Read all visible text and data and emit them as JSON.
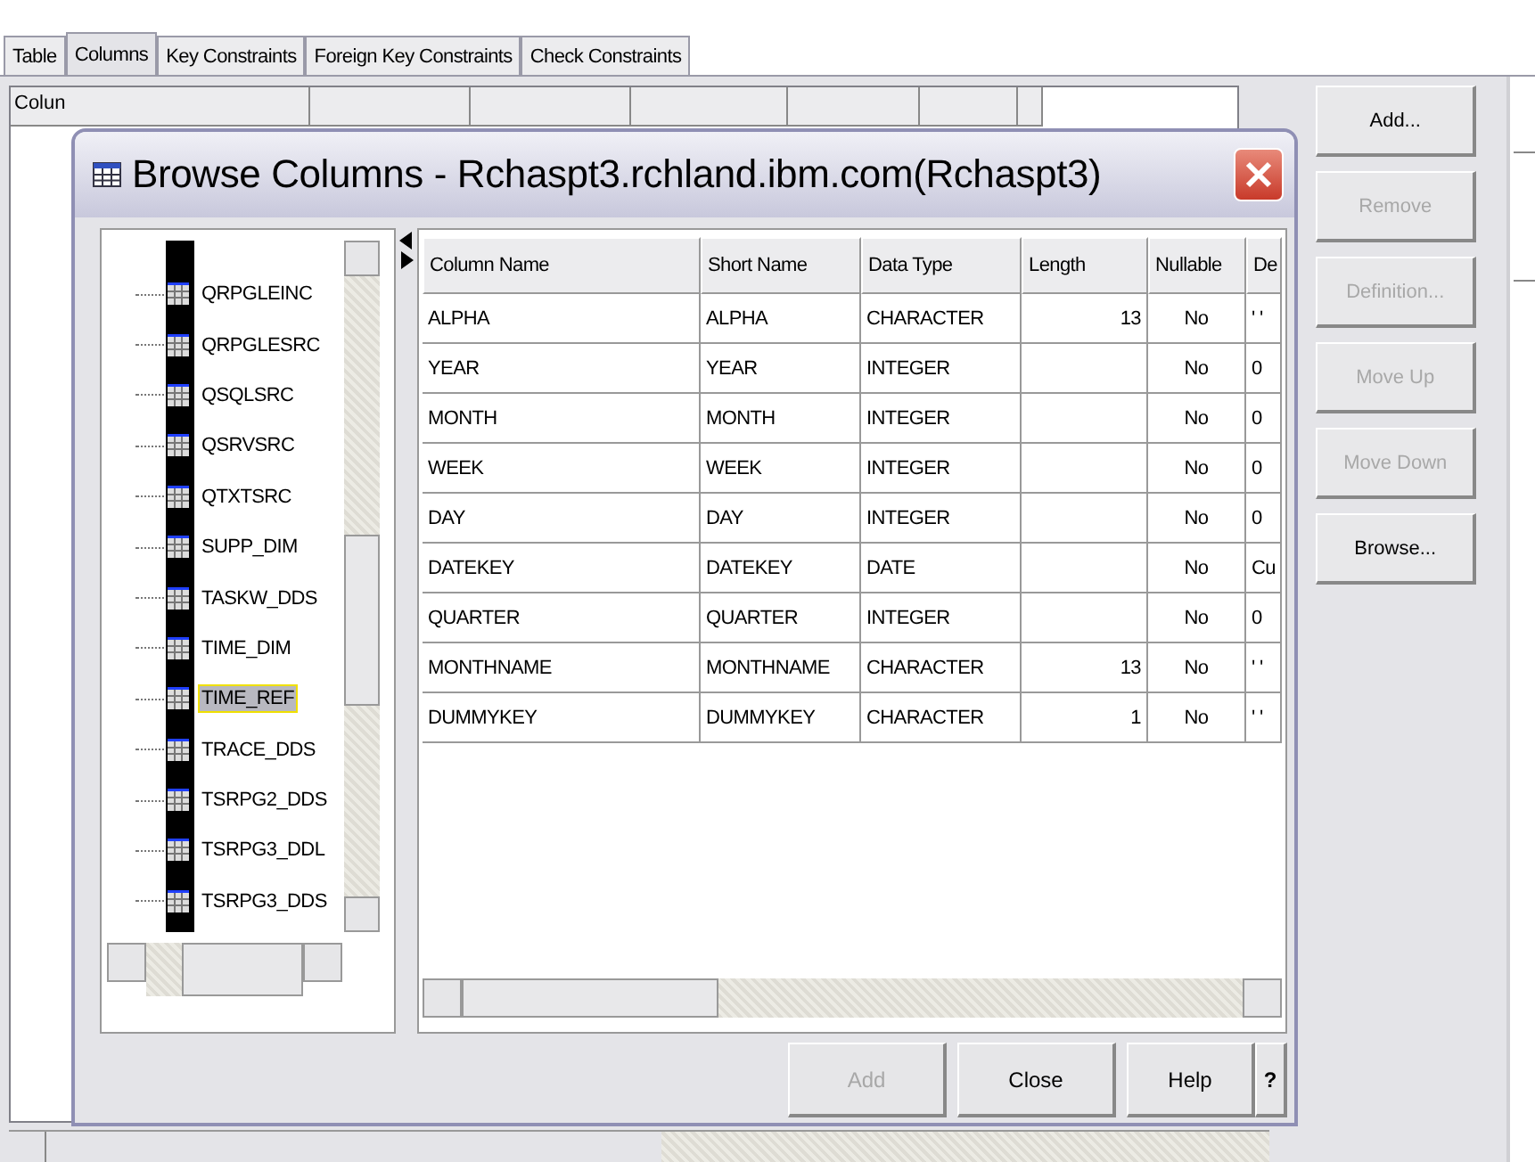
{
  "tabs": [
    {
      "label": "Table",
      "selected": false
    },
    {
      "label": "Columns",
      "selected": true
    },
    {
      "label": "Key Constraints",
      "selected": false
    },
    {
      "label": "Foreign Key Constraints",
      "selected": false
    },
    {
      "label": "Check Constraints",
      "selected": false
    }
  ],
  "background_table": {
    "column_1": "Colun"
  },
  "side_buttons": [
    {
      "label": "Add...",
      "disabled": false
    },
    {
      "label": "Remove",
      "disabled": true
    },
    {
      "label": "Definition...",
      "disabled": true
    },
    {
      "label": "Move Up",
      "disabled": true
    },
    {
      "label": "Move Down",
      "disabled": true
    },
    {
      "label": "Browse...",
      "disabled": false
    }
  ],
  "dialog": {
    "title": "Browse Columns - Rchaspt3.rchland.ibm.com(Rchaspt3)",
    "tree": {
      "items": [
        {
          "label": "QRPGLEINC",
          "selected": false
        },
        {
          "label": "QRPGLESRC",
          "selected": false
        },
        {
          "label": "QSQLSRC",
          "selected": false
        },
        {
          "label": "QSRVSRC",
          "selected": false
        },
        {
          "label": "QTXTSRC",
          "selected": false
        },
        {
          "label": "SUPP_DIM",
          "selected": false
        },
        {
          "label": "TASKW_DDS",
          "selected": false
        },
        {
          "label": "TIME_DIM",
          "selected": false
        },
        {
          "label": "TIME_REF",
          "selected": true
        },
        {
          "label": "TRACE_DDS",
          "selected": false
        },
        {
          "label": "TSRPG2_DDS",
          "selected": false
        },
        {
          "label": "TSRPG3_DDL",
          "selected": false
        },
        {
          "label": "TSRPG3_DDS",
          "selected": false
        }
      ]
    },
    "table": {
      "columns": [
        "Column Name",
        "Short Name",
        "Data Type",
        "Length",
        "Nullable",
        "De"
      ],
      "rows": [
        [
          "ALPHA",
          "ALPHA",
          "CHARACTER",
          "13",
          "No",
          "' '"
        ],
        [
          "YEAR",
          "YEAR",
          "INTEGER",
          "",
          "No",
          "0"
        ],
        [
          "MONTH",
          "MONTH",
          "INTEGER",
          "",
          "No",
          "0"
        ],
        [
          "WEEK",
          "WEEK",
          "INTEGER",
          "",
          "No",
          "0"
        ],
        [
          "DAY",
          "DAY",
          "INTEGER",
          "",
          "No",
          "0"
        ],
        [
          "DATEKEY",
          "DATEKEY",
          "DATE",
          "",
          "No",
          "Cu"
        ],
        [
          "QUARTER",
          "QUARTER",
          "INTEGER",
          "",
          "No",
          "0"
        ],
        [
          "MONTHNAME",
          "MONTHNAME",
          "CHARACTER",
          "13",
          "No",
          "' '"
        ],
        [
          "DUMMYKEY",
          "DUMMYKEY",
          "CHARACTER",
          "1",
          "No",
          "' '"
        ]
      ]
    },
    "buttons": [
      {
        "label": "Add",
        "disabled": true
      },
      {
        "label": "Close",
        "disabled": false
      },
      {
        "label": "Help",
        "disabled": false
      },
      {
        "label": "?",
        "disabled": false
      }
    ]
  }
}
